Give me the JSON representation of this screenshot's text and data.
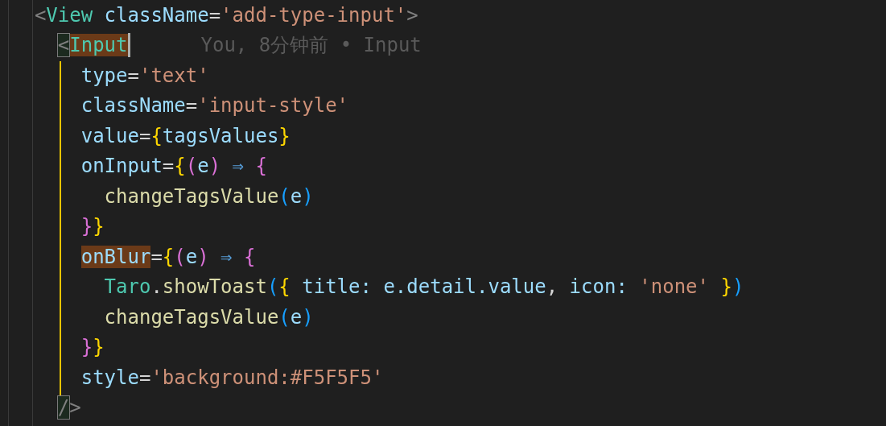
{
  "editor": {
    "lines": [
      {
        "tokens": [
          {
            "text": "  <",
            "kind": "punct"
          },
          {
            "text": "View",
            "kind": "tag"
          },
          {
            "text": " className",
            "kind": "attr"
          },
          {
            "text": "=",
            "kind": "op"
          },
          {
            "text": "'add-type-input'",
            "kind": "string"
          },
          {
            "text": ">",
            "kind": "punct"
          }
        ]
      },
      {
        "tokens": [
          {
            "text": "    <",
            "kind": "punct",
            "bracket_match": true
          },
          {
            "text": "Input",
            "kind": "tag",
            "highlighted": true
          }
        ],
        "cursor": true,
        "blame": "You, 8分钟前 • Input"
      },
      {
        "tokens": [
          {
            "text": "      type",
            "kind": "attr"
          },
          {
            "text": "=",
            "kind": "op"
          },
          {
            "text": "'text'",
            "kind": "string"
          }
        ]
      },
      {
        "tokens": [
          {
            "text": "      className",
            "kind": "attr"
          },
          {
            "text": "=",
            "kind": "op"
          },
          {
            "text": "'input-style'",
            "kind": "string"
          }
        ]
      },
      {
        "tokens": [
          {
            "text": "      value",
            "kind": "attr"
          },
          {
            "text": "=",
            "kind": "op"
          },
          {
            "text": "{",
            "kind": "brace1"
          },
          {
            "text": "tagsValues",
            "kind": "var"
          },
          {
            "text": "}",
            "kind": "brace1"
          }
        ]
      },
      {
        "tokens": [
          {
            "text": "      onInput",
            "kind": "attr"
          },
          {
            "text": "=",
            "kind": "op"
          },
          {
            "text": "{",
            "kind": "brace1"
          },
          {
            "text": "(",
            "kind": "brace2"
          },
          {
            "text": "e",
            "kind": "var"
          },
          {
            "text": ")",
            "kind": "brace2"
          },
          {
            "text": " ⇒ ",
            "kind": "arrow"
          },
          {
            "text": "{",
            "kind": "brace2"
          }
        ]
      },
      {
        "tokens": [
          {
            "text": "        changeTagsValue",
            "kind": "func"
          },
          {
            "text": "(",
            "kind": "brace3"
          },
          {
            "text": "e",
            "kind": "var"
          },
          {
            "text": ")",
            "kind": "brace3"
          }
        ]
      },
      {
        "tokens": [
          {
            "text": "      }",
            "kind": "brace2"
          },
          {
            "text": "}",
            "kind": "brace1"
          }
        ]
      },
      {
        "tokens": [
          {
            "text": "      onBlur",
            "kind": "attr",
            "highlighted": true
          },
          {
            "text": "=",
            "kind": "op"
          },
          {
            "text": "{",
            "kind": "brace1"
          },
          {
            "text": "(",
            "kind": "brace2"
          },
          {
            "text": "e",
            "kind": "var"
          },
          {
            "text": ")",
            "kind": "brace2"
          },
          {
            "text": " ⇒ ",
            "kind": "arrow"
          },
          {
            "text": "{",
            "kind": "brace2"
          }
        ]
      },
      {
        "tokens": [
          {
            "text": "        Taro",
            "kind": "class"
          },
          {
            "text": ".",
            "kind": "op"
          },
          {
            "text": "showToast",
            "kind": "func"
          },
          {
            "text": "(",
            "kind": "brace3"
          },
          {
            "text": "{",
            "kind": "brace1"
          },
          {
            "text": " title: e.detail.value",
            "kind": "var"
          },
          {
            "text": ", ",
            "kind": "op"
          },
          {
            "text": "icon: ",
            "kind": "var"
          },
          {
            "text": "'none' ",
            "kind": "string"
          },
          {
            "text": "}",
            "kind": "brace1"
          },
          {
            "text": ")",
            "kind": "brace3"
          }
        ]
      },
      {
        "tokens": [
          {
            "text": "        changeTagsValue",
            "kind": "func"
          },
          {
            "text": "(",
            "kind": "brace3"
          },
          {
            "text": "e",
            "kind": "var"
          },
          {
            "text": ")",
            "kind": "brace3"
          }
        ]
      },
      {
        "tokens": [
          {
            "text": "      }",
            "kind": "brace2"
          },
          {
            "text": "}",
            "kind": "brace1"
          }
        ]
      },
      {
        "tokens": [
          {
            "text": "      style",
            "kind": "attr"
          },
          {
            "text": "=",
            "kind": "op"
          },
          {
            "text": "'background:#F5F5F5'",
            "kind": "string"
          }
        ]
      },
      {
        "tokens": [
          {
            "text": "    /",
            "kind": "punct",
            "bracket_match": true
          },
          {
            "text": ">",
            "kind": "punct"
          }
        ]
      }
    ]
  }
}
